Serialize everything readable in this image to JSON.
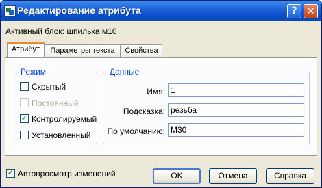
{
  "window": {
    "title": "Редактирование атрибута",
    "help_glyph": "?",
    "close_glyph": "✕"
  },
  "block_label": "Активный блок: шпилька м10",
  "tabs": [
    {
      "label": "Атрибут",
      "active": true
    },
    {
      "label": "Параметры текста",
      "active": false
    },
    {
      "label": "Свойства",
      "active": false
    }
  ],
  "mode": {
    "legend": "Режим",
    "options": [
      {
        "label": "Скрытый",
        "checked": false,
        "enabled": true
      },
      {
        "label": "Постоянный",
        "checked": false,
        "enabled": false
      },
      {
        "label": "Контролируемый",
        "checked": true,
        "enabled": true
      },
      {
        "label": "Установленный",
        "checked": false,
        "enabled": true
      }
    ]
  },
  "data_group": {
    "legend": "Данные",
    "fields": [
      {
        "label": "Имя:",
        "value": "1"
      },
      {
        "label": "Подсказка:",
        "value": "резьба"
      },
      {
        "label": "По умолчанию:",
        "value": "М30"
      }
    ]
  },
  "preview": {
    "label": "Автопросмотр изменений",
    "checked": true
  },
  "buttons": {
    "ok": "OK",
    "cancel": "Отмена",
    "help": "Справка"
  },
  "icons": {
    "app": "autocad-app-icon",
    "check": "checkmark-icon"
  }
}
